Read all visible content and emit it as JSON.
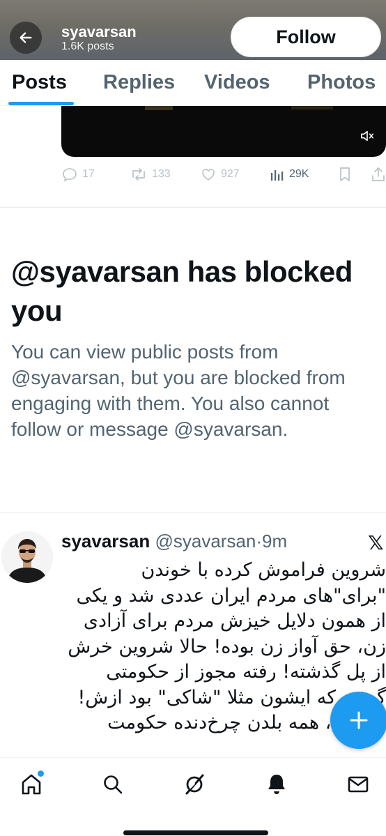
{
  "header": {
    "name": "syavarsan",
    "posts_count": "1.6K posts",
    "follow_label": "Follow",
    "back_icon": "arrow-left-icon"
  },
  "tabs": [
    {
      "label": "Posts",
      "active": true
    },
    {
      "label": "Replies",
      "active": false
    },
    {
      "label": "Videos",
      "active": false
    },
    {
      "label": "Photos",
      "active": false
    }
  ],
  "prev_post": {
    "video_icon": "muted-speaker-icon",
    "replies": "17",
    "reposts": "133",
    "likes": "927",
    "views": "29K"
  },
  "blocked": {
    "title": "@syavarsan has blocked you",
    "text": "You can view public posts from @syavarsan, but you are blocked from engaging with them. You also cannot follow or message @syavarsan."
  },
  "tweet": {
    "name": "syavarsan",
    "handle": "@syavarsan",
    "time": "·9m",
    "x_logo": "𝕏",
    "lines": [
      "شروین فراموش کرده با خوندن",
      "\"برای\"های مردم ایران عددی شد و یکی",
      "از همون دلایل خیزش مردم برای آزادی",
      "زن، حق آواز زن بوده! حالا شروین خرش",
      "از پل گذشته! رفته مجوز از حکومتی",
      "گرفته که ایشون مثلا \"شاکی\" بود ازش!",
      "شروین، همه بلدن چرخ‌دنده حکومت"
    ]
  },
  "fab": {
    "icon": "plus-icon"
  },
  "bottom_nav": [
    "home-icon",
    "search-icon",
    "grok-icon",
    "notifications-bell-icon",
    "messages-envelope-icon"
  ],
  "colors": {
    "accent": "#1d9bf0",
    "text": "#0f1419",
    "secondary": "#536471"
  }
}
